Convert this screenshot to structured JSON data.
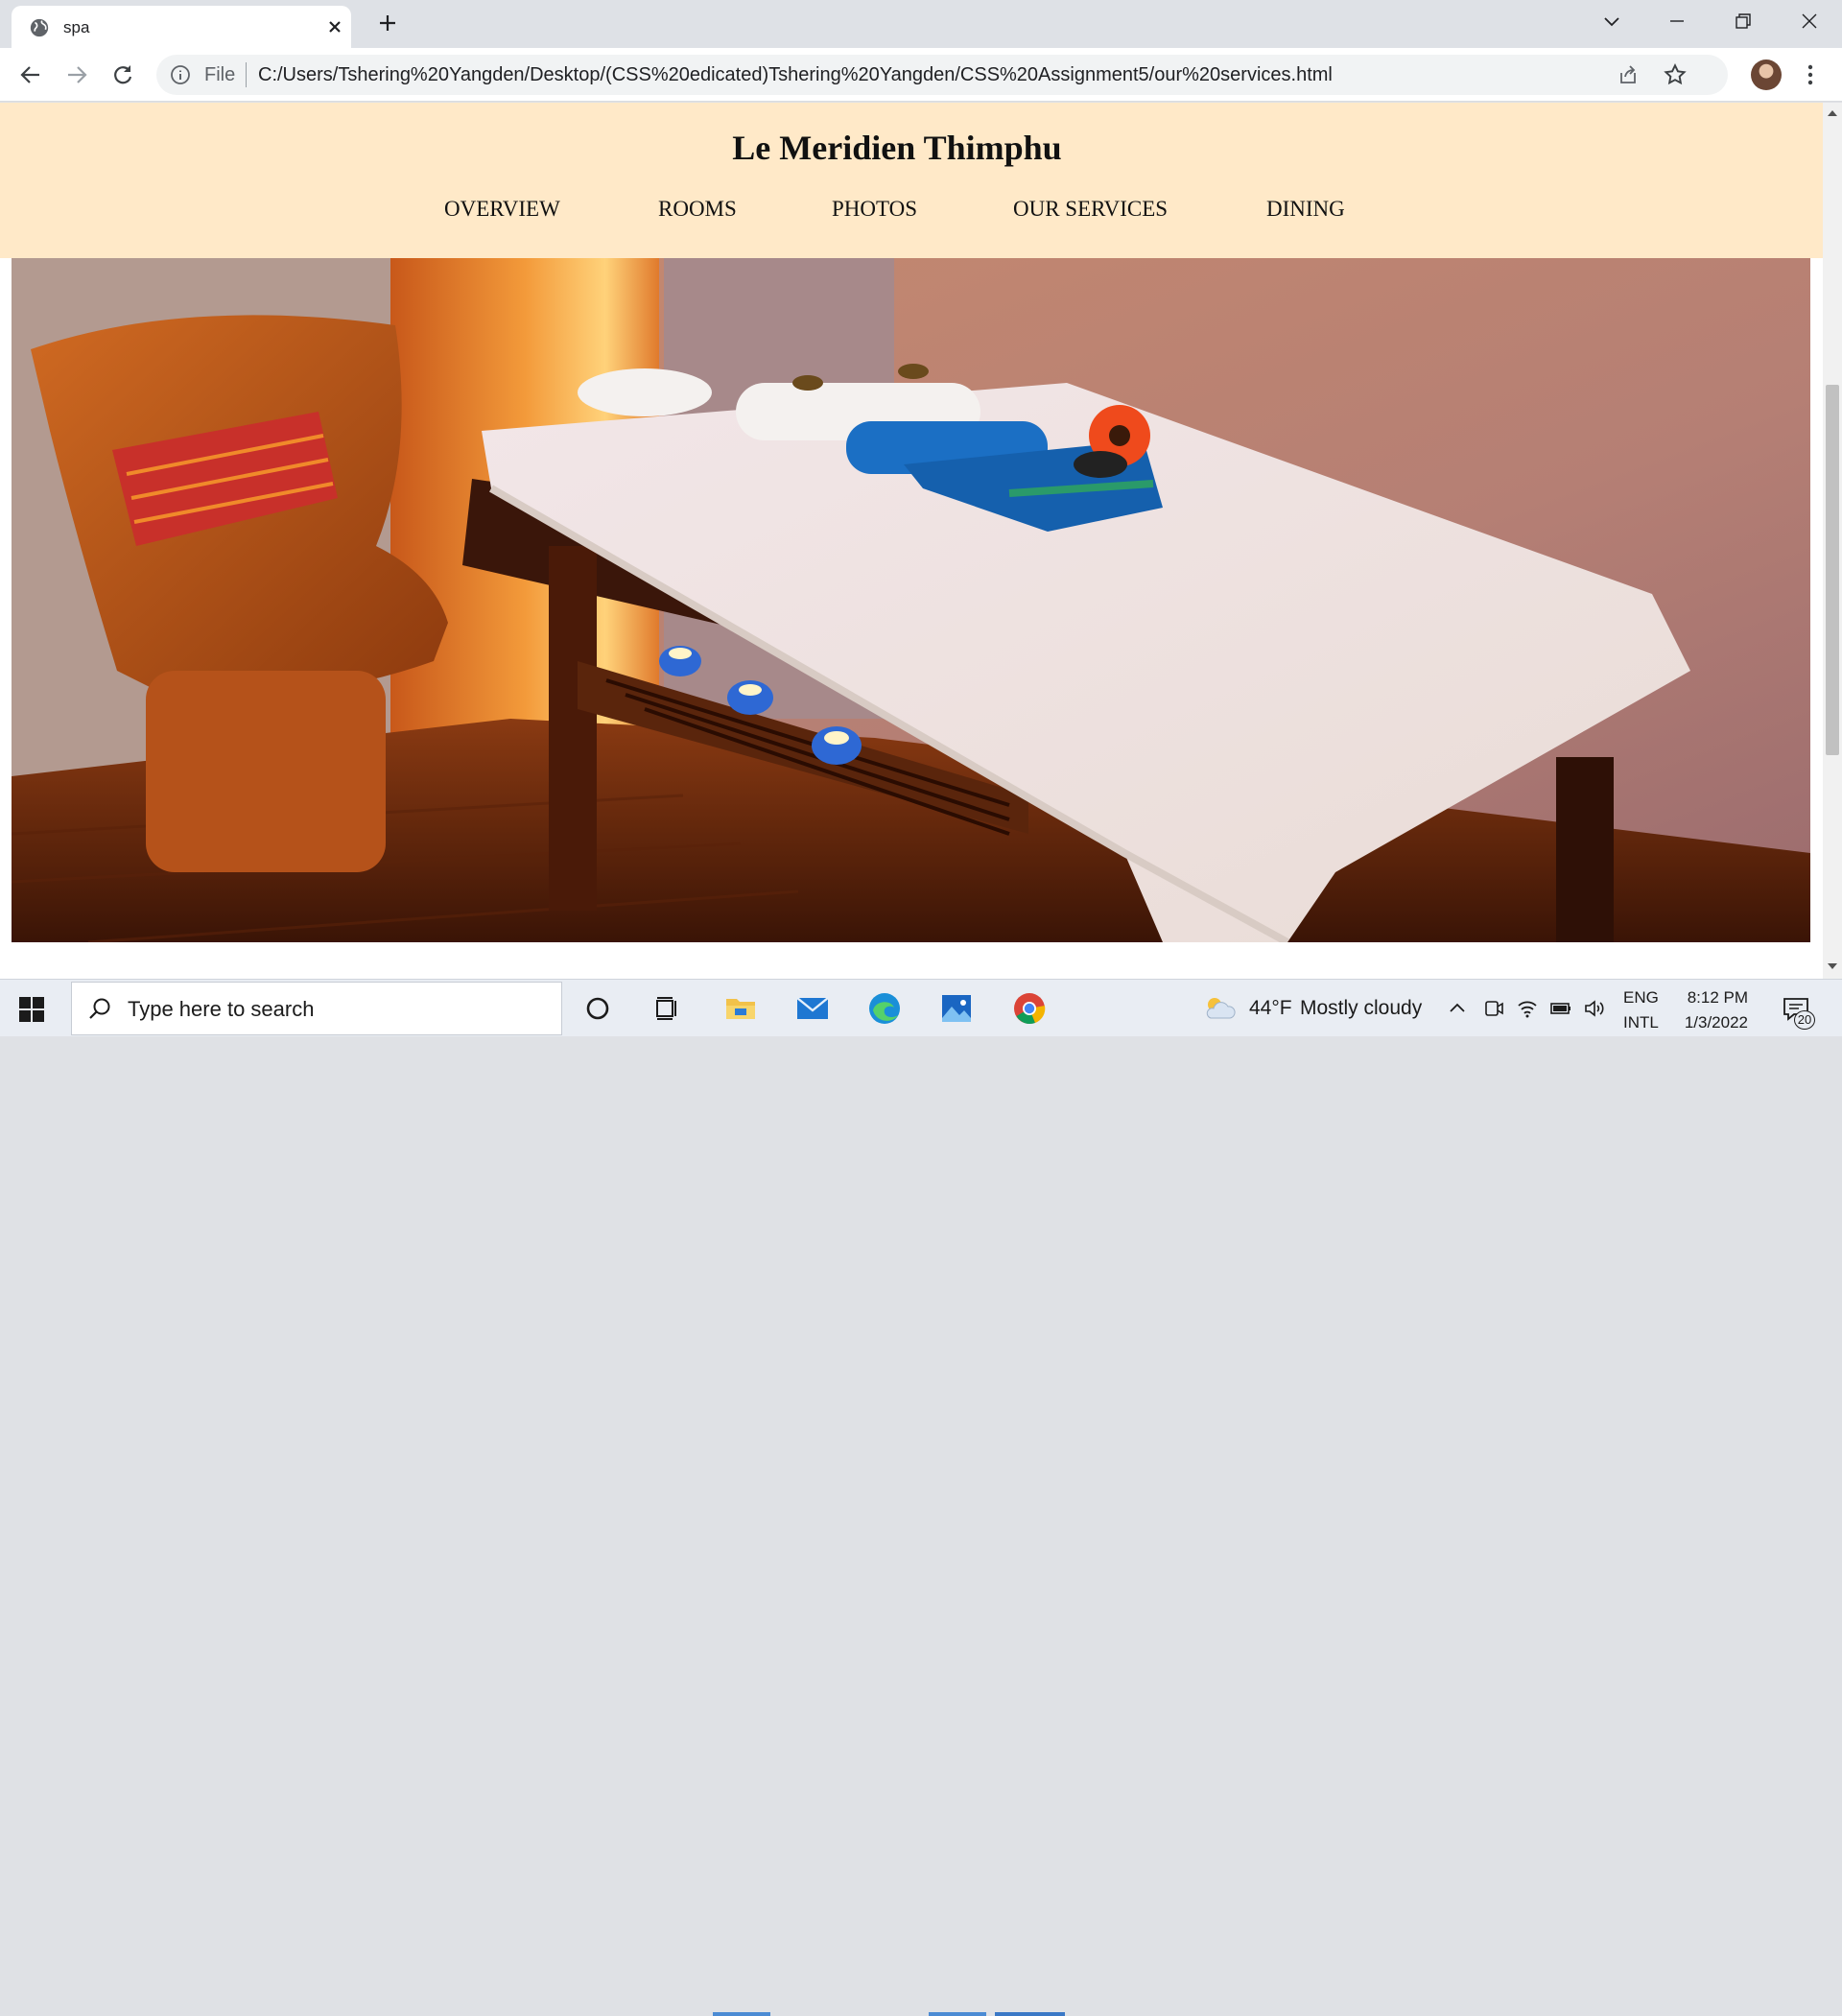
{
  "browser": {
    "tab_title": "spa",
    "address_scheme_label": "File",
    "url": "C:/Users/Tshering%20Yangden/Desktop/(CSS%20edicated)Tshering%20Yangden/CSS%20Assignment5/our%20services.html"
  },
  "page": {
    "site_title": "Le Meridien Thimphu",
    "nav": [
      "OVERVIEW",
      "ROOMS",
      "PHOTOS",
      "OUR SERVICES",
      "DINING"
    ],
    "hero_image": "spa-room-photo"
  },
  "taskbar": {
    "search_placeholder": "Type here to search",
    "weather_temp": "44°F",
    "weather_desc": "Mostly cloudy",
    "lang_primary": "ENG",
    "lang_secondary": "INTL",
    "time": "8:12 PM",
    "date": "1/3/2022",
    "notification_count": "20"
  },
  "colors": {
    "header_bg": "#ffe9c8",
    "accent": "#1a73e8"
  }
}
